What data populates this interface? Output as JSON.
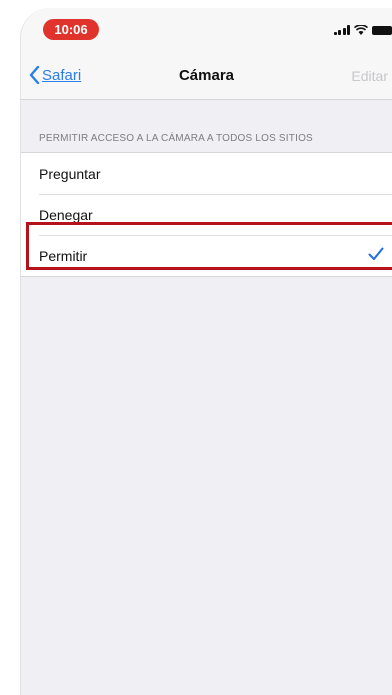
{
  "status_bar": {
    "time": "10:06"
  },
  "nav": {
    "back_label": "Safari",
    "title": "Cámara",
    "edit_label": "Editar"
  },
  "section": {
    "header": "PERMITIR ACCESO A LA CÁMARA A TODOS LOS SITIOS"
  },
  "options": [
    {
      "label": "Preguntar",
      "selected": false
    },
    {
      "label": "Denegar",
      "selected": false
    },
    {
      "label": "Permitir",
      "selected": true
    }
  ],
  "colors": {
    "accent": "#1f6fe0",
    "highlight": "#b5121b",
    "time_pill": "#e0332b"
  }
}
